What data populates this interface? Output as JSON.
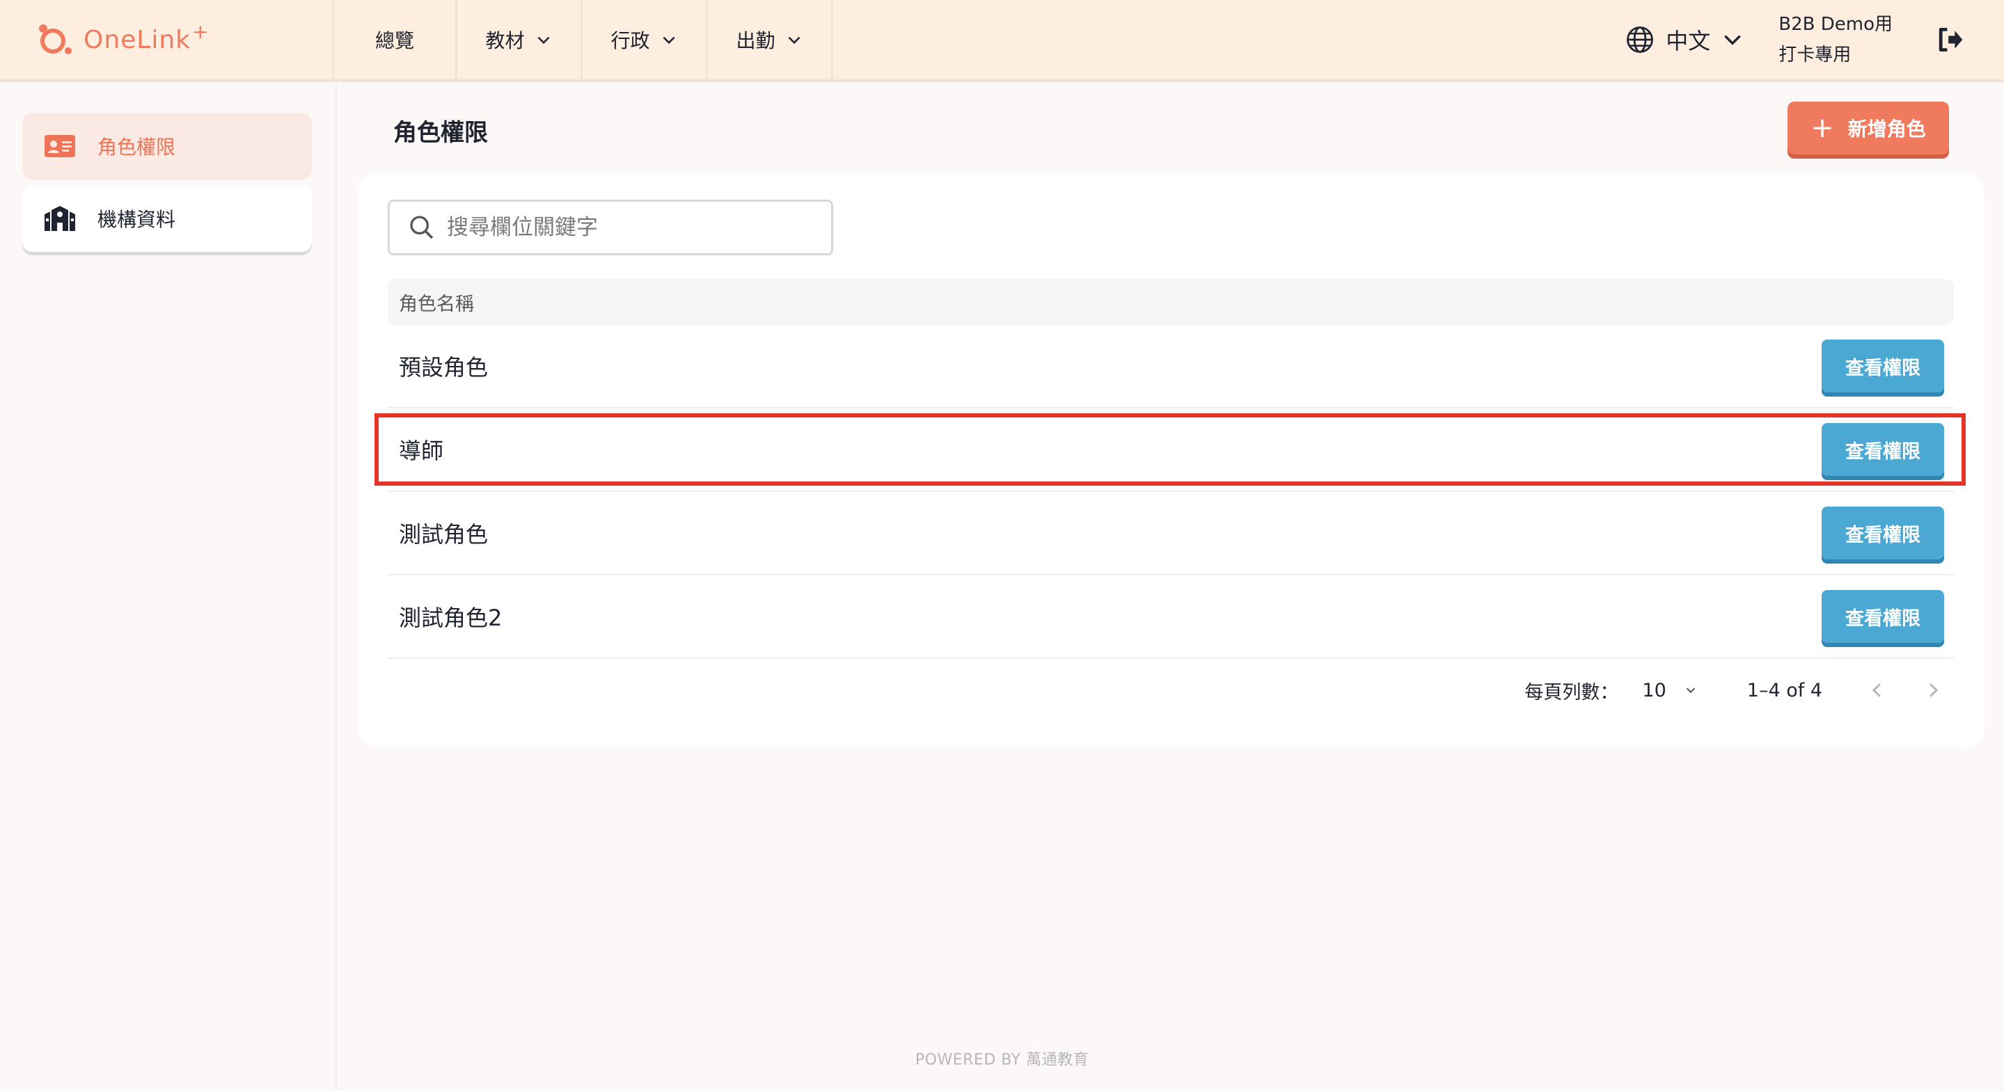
{
  "brand": {
    "name": "OneLink",
    "sup": "+",
    "color": "#f07a5e"
  },
  "nav": [
    {
      "label": "總覽",
      "dropdown": false
    },
    {
      "label": "教材",
      "dropdown": true
    },
    {
      "label": "行政",
      "dropdown": true
    },
    {
      "label": "出勤",
      "dropdown": true
    }
  ],
  "language": {
    "label": "中文",
    "icon": "globe-icon"
  },
  "user": {
    "line1": "B2B Demo用",
    "line2": "打卡專用"
  },
  "sidebar": {
    "items": [
      {
        "label": "角色權限",
        "icon": "id-card-icon",
        "active": true
      },
      {
        "label": "機構資料",
        "icon": "building-icon",
        "active": false
      }
    ]
  },
  "main": {
    "title": "角色權限",
    "add_button": "新增角色",
    "search": {
      "placeholder": "搜尋欄位關鍵字",
      "value": ""
    },
    "table": {
      "column": "角色名稱",
      "rows": [
        {
          "name": "預設角色",
          "action": "查看權限"
        },
        {
          "name": "導師",
          "action": "查看權限",
          "highlighted": true
        },
        {
          "name": "測試角色",
          "action": "查看權限"
        },
        {
          "name": "測試角色2",
          "action": "查看權限"
        }
      ]
    },
    "pagination": {
      "rows_label": "每頁列數：",
      "rows_per_page": "10",
      "range": "1–4 of 4"
    }
  },
  "footer": "POWERED BY 萬通教育",
  "colors": {
    "accent": "#f07a5e",
    "view_button": "#4ba8d3",
    "highlight": "#e3342a",
    "topbar": "#fdeedf"
  }
}
